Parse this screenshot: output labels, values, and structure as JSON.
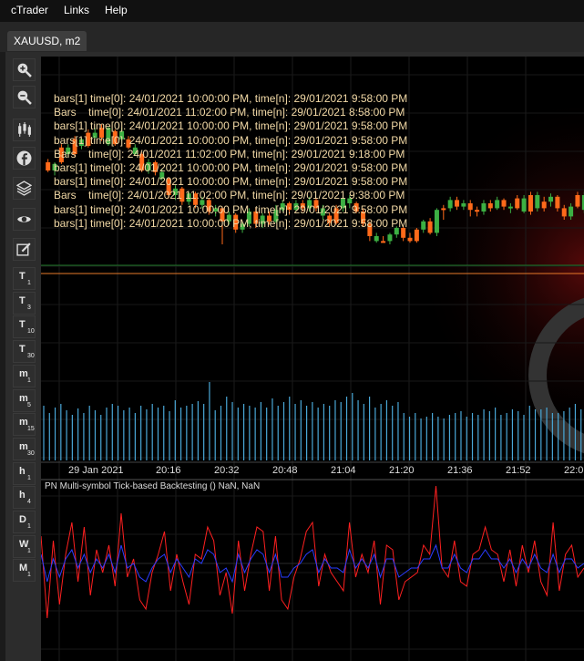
{
  "menu": [
    "cTrader",
    "Links",
    "Help"
  ],
  "tab": {
    "label": "XAUUSD, m2"
  },
  "toolbar": {
    "icons": [
      "zoom-in-icon",
      "zoom-out-icon",
      "chart-type-icon",
      "facebook-icon",
      "layers-icon",
      "eye-icon",
      "settings-icon"
    ],
    "timeframes": [
      {
        "big": "T",
        "sub": "1"
      },
      {
        "big": "T",
        "sub": "3"
      },
      {
        "big": "T",
        "sub": "10"
      },
      {
        "big": "T",
        "sub": "30"
      },
      {
        "big": "m",
        "sub": "1"
      },
      {
        "big": "m",
        "sub": "5"
      },
      {
        "big": "m",
        "sub": "15"
      },
      {
        "big": "m",
        "sub": "30"
      },
      {
        "big": "h",
        "sub": "1"
      },
      {
        "big": "h",
        "sub": "4"
      },
      {
        "big": "D",
        "sub": "1"
      },
      {
        "big": "W",
        "sub": "1"
      },
      {
        "big": "M",
        "sub": "1"
      }
    ]
  },
  "log_lines": [
    "bars[1] time[0]: 24/01/2021 10:00:00 PM, time[n]: 29/01/2021 9:58:00 PM",
    "Bars    time[0]: 24/01/2021 11:02:00 PM, time[n]: 29/01/2021 8:58:00 PM",
    "bars[1] time[0]: 24/01/2021 10:00:00 PM, time[n]: 29/01/2021 9:58:00 PM",
    "bars[1] time[0]: 24/01/2021 10:00:00 PM, time[n]: 29/01/2021 9:58:00 PM",
    "Bars    time[0]: 24/01/2021 11:02:00 PM, time[n]: 29/01/2021 9:18:00 PM",
    "bars[1] time[0]: 24/01/2021 10:00:00 PM, time[n]: 29/01/2021 9:58:00 PM",
    "bars[1] time[0]: 24/01/2021 10:00:00 PM, time[n]: 29/01/2021 9:58:00 PM",
    "Bars    time[0]: 24/01/2021 11:02:00 PM, time[n]: 29/01/2021 9:38:00 PM",
    "bars[1] time[0]: 24/01/2021 10:00:00 PM, time[n]: 29/01/2021 9:58:00 PM",
    "bars[1] time[0]: 24/01/2021 10:00:00 PM, time[n]: 29/01/2021 9:58:00 PM"
  ],
  "time_axis": [
    "29 Jan 2021",
    "20:16",
    "20:32",
    "20:48",
    "21:04",
    "21:20",
    "21:36",
    "21:52",
    "22:0"
  ],
  "indicator_title": "PN Multi-symbol Tick-based Backtesting () NaN, NaN",
  "colors": {
    "bull": "#3cb043",
    "bear": "#ff6a1a",
    "volume": "#4aa8d8",
    "red_line": "#ff2020",
    "blue_line": "#2a3cff",
    "accent": "#e87a2a"
  },
  "candles": [
    [
      0,
      140,
      150,
      152,
      136
    ],
    [
      1,
      150,
      142,
      156,
      140
    ],
    [
      0,
      140,
      122,
      142,
      118
    ],
    [
      1,
      122,
      130,
      134,
      118
    ],
    [
      0,
      130,
      112,
      134,
      108
    ],
    [
      1,
      112,
      120,
      124,
      110
    ],
    [
      0,
      120,
      104,
      122,
      100
    ],
    [
      1,
      104,
      110,
      112,
      98
    ],
    [
      0,
      110,
      98,
      114,
      94
    ],
    [
      1,
      98,
      118,
      120,
      96
    ],
    [
      0,
      118,
      102,
      120,
      100
    ],
    [
      1,
      102,
      112,
      114,
      98
    ],
    [
      0,
      112,
      122,
      124,
      108
    ],
    [
      1,
      122,
      130,
      132,
      118
    ],
    [
      0,
      130,
      150,
      152,
      128
    ],
    [
      1,
      150,
      140,
      154,
      136
    ],
    [
      0,
      140,
      152,
      156,
      138
    ],
    [
      1,
      152,
      160,
      162,
      148
    ],
    [
      0,
      160,
      180,
      184,
      158
    ],
    [
      1,
      180,
      172,
      186,
      168
    ],
    [
      0,
      172,
      188,
      192,
      170
    ],
    [
      1,
      188,
      178,
      192,
      176
    ],
    [
      0,
      178,
      192,
      196,
      176
    ],
    [
      1,
      192,
      186,
      196,
      182
    ],
    [
      0,
      186,
      200,
      204,
      184
    ],
    [
      1,
      200,
      196,
      206,
      192
    ],
    [
      0,
      196,
      212,
      240,
      194
    ],
    [
      1,
      212,
      204,
      216,
      200
    ],
    [
      0,
      204,
      222,
      226,
      202
    ],
    [
      1,
      222,
      215,
      226,
      212
    ],
    [
      1,
      215,
      200,
      218,
      196
    ],
    [
      0,
      200,
      215,
      220,
      196
    ],
    [
      1,
      215,
      205,
      220,
      202
    ],
    [
      0,
      205,
      212,
      216,
      200
    ],
    [
      1,
      212,
      198,
      214,
      192
    ],
    [
      1,
      198,
      190,
      200,
      186
    ],
    [
      0,
      190,
      198,
      204,
      188
    ],
    [
      1,
      198,
      190,
      200,
      186
    ],
    [
      0,
      190,
      196,
      200,
      186
    ],
    [
      1,
      196,
      186,
      200,
      182
    ],
    [
      0,
      186,
      196,
      200,
      184
    ],
    [
      1,
      196,
      205,
      210,
      192
    ],
    [
      0,
      205,
      214,
      218,
      202
    ],
    [
      0,
      214,
      196,
      216,
      192
    ],
    [
      1,
      196,
      184,
      200,
      182
    ],
    [
      1,
      184,
      190,
      196,
      180
    ],
    [
      0,
      190,
      200,
      202,
      188
    ],
    [
      0,
      200,
      215,
      218,
      196
    ],
    [
      0,
      215,
      230,
      236,
      212
    ],
    [
      1,
      230,
      236,
      238,
      226
    ],
    [
      0,
      236,
      236,
      238,
      230
    ],
    [
      1,
      236,
      228,
      240,
      226
    ],
    [
      1,
      228,
      220,
      232,
      218
    ],
    [
      0,
      220,
      232,
      236,
      218
    ],
    [
      0,
      232,
      236,
      238,
      226
    ],
    [
      0,
      236,
      222,
      238,
      220
    ],
    [
      1,
      222,
      212,
      226,
      210
    ],
    [
      0,
      212,
      226,
      228,
      208
    ],
    [
      1,
      226,
      198,
      230,
      196
    ],
    [
      0,
      198,
      196,
      210,
      192
    ],
    [
      1,
      196,
      186,
      200,
      182
    ],
    [
      0,
      186,
      194,
      198,
      182
    ],
    [
      1,
      194,
      190,
      198,
      186
    ],
    [
      0,
      190,
      198,
      206,
      186
    ],
    [
      0,
      198,
      200,
      206,
      194
    ],
    [
      1,
      200,
      190,
      204,
      186
    ],
    [
      0,
      190,
      196,
      200,
      186
    ],
    [
      1,
      196,
      186,
      198,
      182
    ],
    [
      0,
      186,
      194,
      198,
      184
    ],
    [
      1,
      194,
      196,
      202,
      190
    ],
    [
      0,
      196,
      184,
      198,
      180
    ],
    [
      1,
      184,
      200,
      202,
      180
    ],
    [
      0,
      200,
      180,
      204,
      176
    ],
    [
      1,
      180,
      196,
      200,
      176
    ],
    [
      0,
      196,
      188,
      200,
      182
    ],
    [
      1,
      188,
      182,
      194,
      178
    ],
    [
      0,
      182,
      196,
      200,
      180
    ],
    [
      0,
      196,
      206,
      210,
      192
    ],
    [
      1,
      206,
      194,
      210,
      190
    ],
    [
      0,
      194,
      180,
      196,
      176
    ],
    [
      1,
      180,
      198,
      202,
      176
    ]
  ],
  "volumes": [
    60,
    52,
    58,
    62,
    55,
    50,
    57,
    52,
    60,
    55,
    50,
    58,
    62,
    60,
    55,
    58,
    52,
    60,
    56,
    62,
    58,
    60,
    54,
    66,
    58,
    60,
    62,
    65,
    62,
    86,
    55,
    60,
    70,
    64,
    58,
    62,
    60,
    58,
    64,
    58,
    68,
    60,
    64,
    70,
    62,
    66,
    60,
    64,
    58,
    62,
    60,
    66,
    64,
    70,
    74,
    66,
    62,
    70,
    58,
    62,
    66,
    60,
    64,
    52,
    48,
    52,
    46,
    48,
    52,
    48,
    46,
    50,
    52,
    54,
    48,
    52,
    50,
    56,
    54,
    58,
    50,
    52,
    56,
    54,
    50,
    60,
    56,
    56,
    58,
    52,
    52,
    54,
    58,
    62,
    56
  ],
  "red_series": [
    30,
    -60,
    25,
    -45,
    10,
    45,
    -20,
    40,
    -35,
    15,
    -10,
    20,
    -25,
    55,
    -15,
    5,
    -40,
    -50,
    -10,
    10,
    35,
    -30,
    10,
    -20,
    -45,
    10,
    5,
    40,
    25,
    -35,
    -10,
    -55,
    25,
    -30,
    10,
    40,
    35,
    -30,
    30,
    -40,
    -50,
    -15,
    5,
    35,
    45,
    -25,
    10,
    -10,
    -20,
    -30,
    45,
    -15,
    10,
    -10,
    25,
    -45,
    20,
    15,
    -40,
    -20,
    -15,
    -10,
    20,
    10,
    85,
    -5,
    -15,
    25,
    -20,
    -25,
    10,
    15,
    40,
    15,
    10,
    -20,
    15,
    -25,
    20,
    -10,
    25,
    -20,
    -35,
    45,
    -30,
    10,
    20,
    -15,
    -5
  ],
  "blue_series": [
    10,
    -20,
    5,
    -15,
    5,
    15,
    -5,
    10,
    -10,
    5,
    -5,
    10,
    -10,
    20,
    -5,
    0,
    -15,
    -20,
    -5,
    5,
    10,
    -10,
    5,
    -5,
    -15,
    5,
    0,
    15,
    10,
    -10,
    -5,
    -20,
    10,
    -10,
    5,
    15,
    10,
    -10,
    10,
    -15,
    -15,
    -5,
    0,
    10,
    15,
    -10,
    5,
    -5,
    -5,
    -10,
    15,
    -5,
    5,
    -5,
    10,
    -15,
    5,
    5,
    -15,
    -10,
    -5,
    -5,
    5,
    5,
    20,
    -5,
    -5,
    10,
    -5,
    -10,
    5,
    5,
    15,
    5,
    5,
    -5,
    5,
    -10,
    5,
    -5,
    10,
    -5,
    -10,
    10,
    -10,
    5,
    5,
    -5,
    0
  ]
}
